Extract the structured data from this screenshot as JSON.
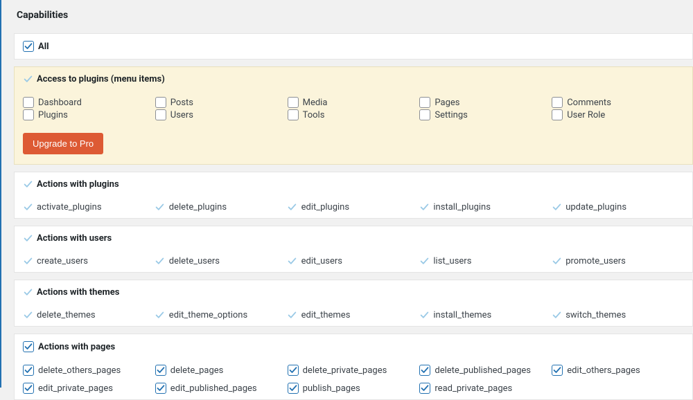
{
  "page_title": "Capabilities",
  "all_section": {
    "label": "All",
    "checked": true
  },
  "access_plugins": {
    "header": "Access to plugins (menu items)",
    "header_checked": "ghost",
    "rows": [
      [
        {
          "label": "Dashboard",
          "checked": false
        },
        {
          "label": "Posts",
          "checked": false
        },
        {
          "label": "Media",
          "checked": false
        },
        {
          "label": "Pages",
          "checked": false
        },
        {
          "label": "Comments",
          "checked": false
        }
      ],
      [
        {
          "label": "Plugins",
          "checked": false
        },
        {
          "label": "Users",
          "checked": false
        },
        {
          "label": "Tools",
          "checked": false
        },
        {
          "label": "Settings",
          "checked": false
        },
        {
          "label": "User Role",
          "checked": false
        }
      ]
    ],
    "upgrade_button": "Upgrade to Pro"
  },
  "sections": [
    {
      "header": "Actions with plugins",
      "header_checked": "ghost",
      "rows": [
        [
          {
            "label": "activate_plugins",
            "checked": "ghost"
          },
          {
            "label": "delete_plugins",
            "checked": "ghost"
          },
          {
            "label": "edit_plugins",
            "checked": "ghost"
          },
          {
            "label": "install_plugins",
            "checked": "ghost"
          },
          {
            "label": "update_plugins",
            "checked": "ghost"
          }
        ]
      ]
    },
    {
      "header": "Actions with users",
      "header_checked": "ghost",
      "rows": [
        [
          {
            "label": "create_users",
            "checked": "ghost"
          },
          {
            "label": "delete_users",
            "checked": "ghost"
          },
          {
            "label": "edit_users",
            "checked": "ghost"
          },
          {
            "label": "list_users",
            "checked": "ghost"
          },
          {
            "label": "promote_users",
            "checked": "ghost"
          }
        ]
      ]
    },
    {
      "header": "Actions with themes",
      "header_checked": "ghost",
      "rows": [
        [
          {
            "label": "delete_themes",
            "checked": "ghost"
          },
          {
            "label": "edit_theme_options",
            "checked": "ghost"
          },
          {
            "label": "edit_themes",
            "checked": "ghost"
          },
          {
            "label": "install_themes",
            "checked": "ghost"
          },
          {
            "label": "switch_themes",
            "checked": "ghost"
          }
        ]
      ]
    },
    {
      "header": "Actions with pages",
      "header_checked": true,
      "rows": [
        [
          {
            "label": "delete_others_pages",
            "checked": true
          },
          {
            "label": "delete_pages",
            "checked": true
          },
          {
            "label": "delete_private_pages",
            "checked": true
          },
          {
            "label": "delete_published_pages",
            "checked": true
          },
          {
            "label": "edit_others_pages",
            "checked": true
          }
        ],
        [
          {
            "label": "edit_private_pages",
            "checked": true
          },
          {
            "label": "edit_published_pages",
            "checked": true
          },
          {
            "label": "publish_pages",
            "checked": true
          },
          {
            "label": "read_private_pages",
            "checked": true
          },
          {
            "label": "",
            "checked": null
          }
        ]
      ]
    }
  ]
}
